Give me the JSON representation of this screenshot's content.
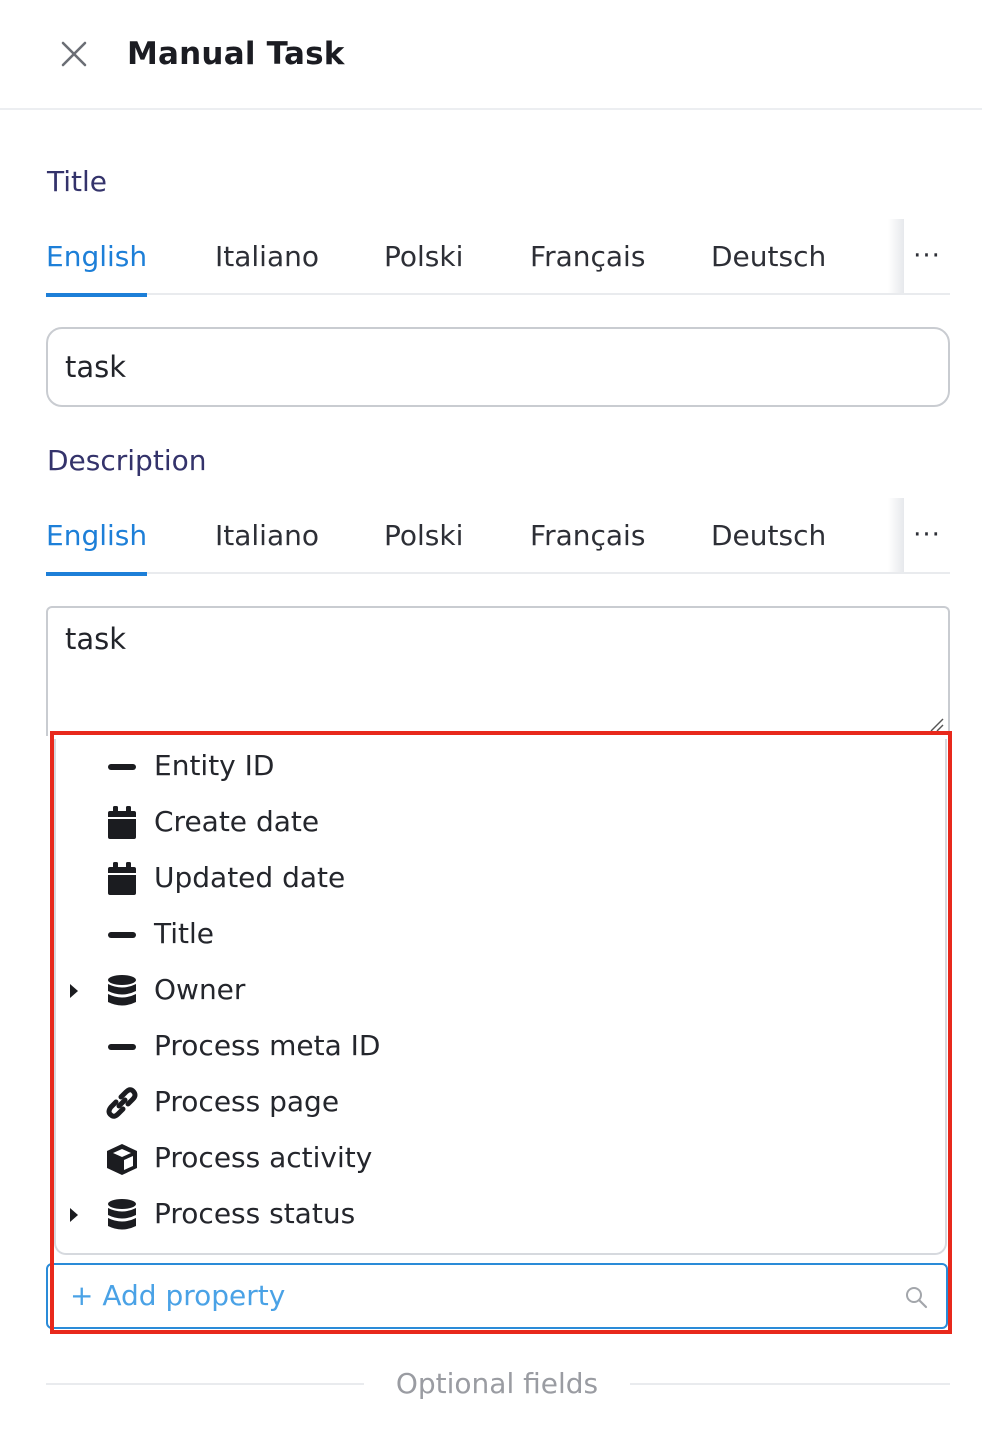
{
  "header": {
    "title": "Manual Task",
    "close_icon": "close-icon"
  },
  "title_section": {
    "label": "Title",
    "tabs": [
      {
        "label": "English",
        "active": true
      },
      {
        "label": "Italiano",
        "active": false
      },
      {
        "label": "Polski",
        "active": false
      },
      {
        "label": "Français",
        "active": false
      },
      {
        "label": "Deutsch",
        "active": false
      }
    ],
    "more_label": "···",
    "value": "task"
  },
  "description_section": {
    "label": "Description",
    "tabs": [
      {
        "label": "English",
        "active": true
      },
      {
        "label": "Italiano",
        "active": false
      },
      {
        "label": "Polski",
        "active": false
      },
      {
        "label": "Français",
        "active": false
      },
      {
        "label": "Deutsch",
        "active": false
      }
    ],
    "more_label": "···",
    "value": "task"
  },
  "property_dropdown": {
    "items": [
      {
        "label": "Entity ID",
        "icon": "dash-icon",
        "expandable": false
      },
      {
        "label": "Create date",
        "icon": "calendar-icon",
        "expandable": false
      },
      {
        "label": "Updated date",
        "icon": "calendar-icon",
        "expandable": false
      },
      {
        "label": "Title",
        "icon": "dash-icon",
        "expandable": false
      },
      {
        "label": "Owner",
        "icon": "database-icon",
        "expandable": true
      },
      {
        "label": "Process meta ID",
        "icon": "dash-icon",
        "expandable": false
      },
      {
        "label": "Process page",
        "icon": "link-icon",
        "expandable": false
      },
      {
        "label": "Process activity",
        "icon": "cube-icon",
        "expandable": false
      },
      {
        "label": "Process status",
        "icon": "database-icon",
        "expandable": true
      }
    ]
  },
  "add_property": {
    "label": "+ Add property",
    "icon": "search-icon"
  },
  "optional_fields": {
    "label": "Optional fields"
  },
  "colors": {
    "accent": "#1d7fd8",
    "highlight": "#e8291c",
    "label": "#34336b"
  }
}
